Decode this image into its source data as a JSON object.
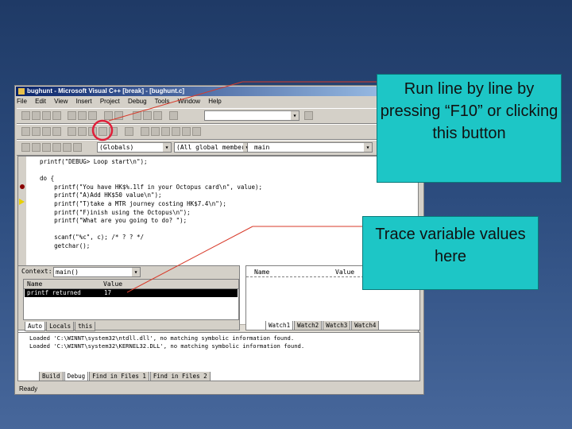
{
  "window": {
    "title": "bughunt - Microsoft Visual C++ [break] - [bughunt.c]",
    "menu": [
      "File",
      "Edit",
      "View",
      "Insert",
      "Project",
      "Debug",
      "Tools",
      "Window",
      "Help"
    ]
  },
  "toolbar": {
    "context_combo": "(Globals)",
    "members_combo": "(All global members",
    "function_combo": "main"
  },
  "code": {
    "lines": [
      "  printf(\"DEBUG> Loop start\\n\");",
      "",
      "  do {",
      "      printf(\"You have HK$%.1lf in your Octopus card\\n\", value);",
      "      printf(\"A)Add HK$50 value\\n\");",
      "      printf(\"T)take a MTR journey costing HK$7.4\\n\");",
      "      printf(\"F)inish using the Octopus\\n\");",
      "      printf(\"What are you going to do? \");",
      "",
      "      scanf(\"%c\", c); /* ? ? */",
      "      getchar();"
    ]
  },
  "variables": {
    "context_label": "Context:",
    "context_value": "main()",
    "col_name": "Name",
    "col_value": "Value",
    "row_name": "printf returned",
    "row_value": "17",
    "tabs": [
      "Auto",
      "Locals",
      "this"
    ]
  },
  "watch": {
    "col_name": "Name",
    "col_value": "Value",
    "tabs": [
      "Watch1",
      "Watch2",
      "Watch3",
      "Watch4"
    ]
  },
  "output": {
    "lines": [
      "Loaded 'C:\\WINNT\\system32\\ntdll.dll', no matching symbolic information found.",
      "Loaded 'C:\\WINNT\\system32\\KERNEL32.DLL', no matching symbolic information found."
    ],
    "tabs": [
      "Build",
      "Debug",
      "Find in Files 1",
      "Find in Files 2"
    ]
  },
  "status": {
    "text": "Ready"
  },
  "callouts": {
    "run": "Run line by line by pressing “F10” or clicking this button",
    "trace": "Trace variable values here"
  },
  "colors": {
    "callout_fill": "#1dc6c6",
    "highlight_circle": "#e0203a",
    "pointer_line": "#d83a2a"
  }
}
